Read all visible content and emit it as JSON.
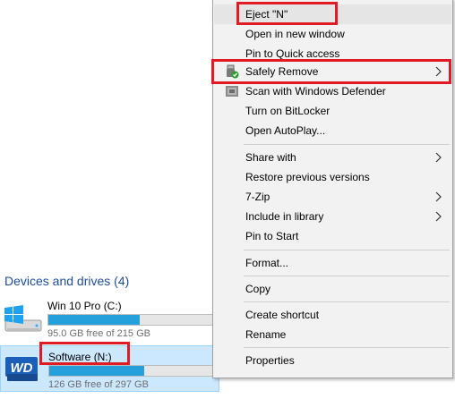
{
  "explorer": {
    "section_header": "Devices and drives (4)",
    "drives": [
      {
        "name": "Win 10 Pro (C:)",
        "free_text": "95.0 GB free of 215 GB",
        "used_fraction": 0.56,
        "icon": "windows-drive-icon",
        "selected": false
      },
      {
        "name": "Software (N:)",
        "free_text": "126 GB free of 297 GB",
        "used_fraction": 0.58,
        "icon": "wd-drive-icon",
        "selected": true
      }
    ]
  },
  "context_menu": {
    "items": [
      {
        "label": "Eject \"N\"",
        "icon": null,
        "submenu": false,
        "hovered": true,
        "highlighted": true
      },
      {
        "label": "Open in new window",
        "icon": null,
        "submenu": false
      },
      {
        "label": "Pin to Quick access",
        "icon": null,
        "submenu": false
      },
      {
        "label": "Safely Remove",
        "icon": "usb-safely-remove-icon",
        "submenu": true,
        "highlighted": true
      },
      {
        "label": "Scan with Windows Defender",
        "icon": "windows-defender-icon",
        "submenu": false
      },
      {
        "label": "Turn on BitLocker",
        "icon": null,
        "submenu": false
      },
      {
        "label": "Open AutoPlay...",
        "icon": null,
        "submenu": false
      },
      {
        "label": "Share with",
        "icon": null,
        "submenu": true
      },
      {
        "label": "Restore previous versions",
        "icon": null,
        "submenu": false
      },
      {
        "label": "7-Zip",
        "icon": null,
        "submenu": true
      },
      {
        "label": "Include in library",
        "icon": null,
        "submenu": true
      },
      {
        "label": "Pin to Start",
        "icon": null,
        "submenu": false
      },
      {
        "label": "Format...",
        "icon": null,
        "submenu": false
      },
      {
        "label": "Copy",
        "icon": null,
        "submenu": false
      },
      {
        "label": "Create shortcut",
        "icon": null,
        "submenu": false
      },
      {
        "label": "Rename",
        "icon": null,
        "submenu": false
      },
      {
        "label": "Properties",
        "icon": null,
        "submenu": false
      }
    ]
  },
  "colors": {
    "highlight_box": "#e01b24",
    "bar_fill": "#26a0da",
    "selection": "#cce8ff",
    "header_text": "#1e4e9a"
  }
}
